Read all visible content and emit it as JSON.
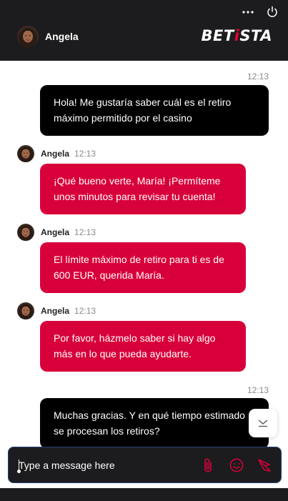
{
  "header": {
    "agent_name": "Angela",
    "logo_prefix": "BET",
    "logo_dot": "i",
    "logo_suffix": "STA",
    "icons": [
      "more-icon",
      "power-icon"
    ]
  },
  "messages": [
    {
      "type": "user",
      "time": "12:13",
      "text": "Hola! Me gustaría saber cuál es el retiro máximo permitido por el casino"
    },
    {
      "type": "agent",
      "sender": "Angela",
      "time": "12:13",
      "text": "¡Qué bueno verte, María! ¡Permíteme unos minutos para revisar tu cuenta!"
    },
    {
      "type": "agent",
      "sender": "Angela",
      "time": "12:13",
      "text": "El límite máximo de retiro para ti es de 600 EUR, querida María."
    },
    {
      "type": "agent",
      "sender": "Angela",
      "time": "12:13",
      "text": "Por favor, házmelo saber si hay algo más en lo que pueda ayudarte."
    },
    {
      "type": "user",
      "time": "12:13",
      "text": "Muchas gracias. Y en qué tiempo estimado se procesan los retiros?"
    }
  ],
  "composer": {
    "placeholder": "Type a message here",
    "value": ""
  },
  "colors": {
    "brand": "#d8003a",
    "user_bubble": "#000000",
    "header_bg": "#1c1c1e"
  }
}
